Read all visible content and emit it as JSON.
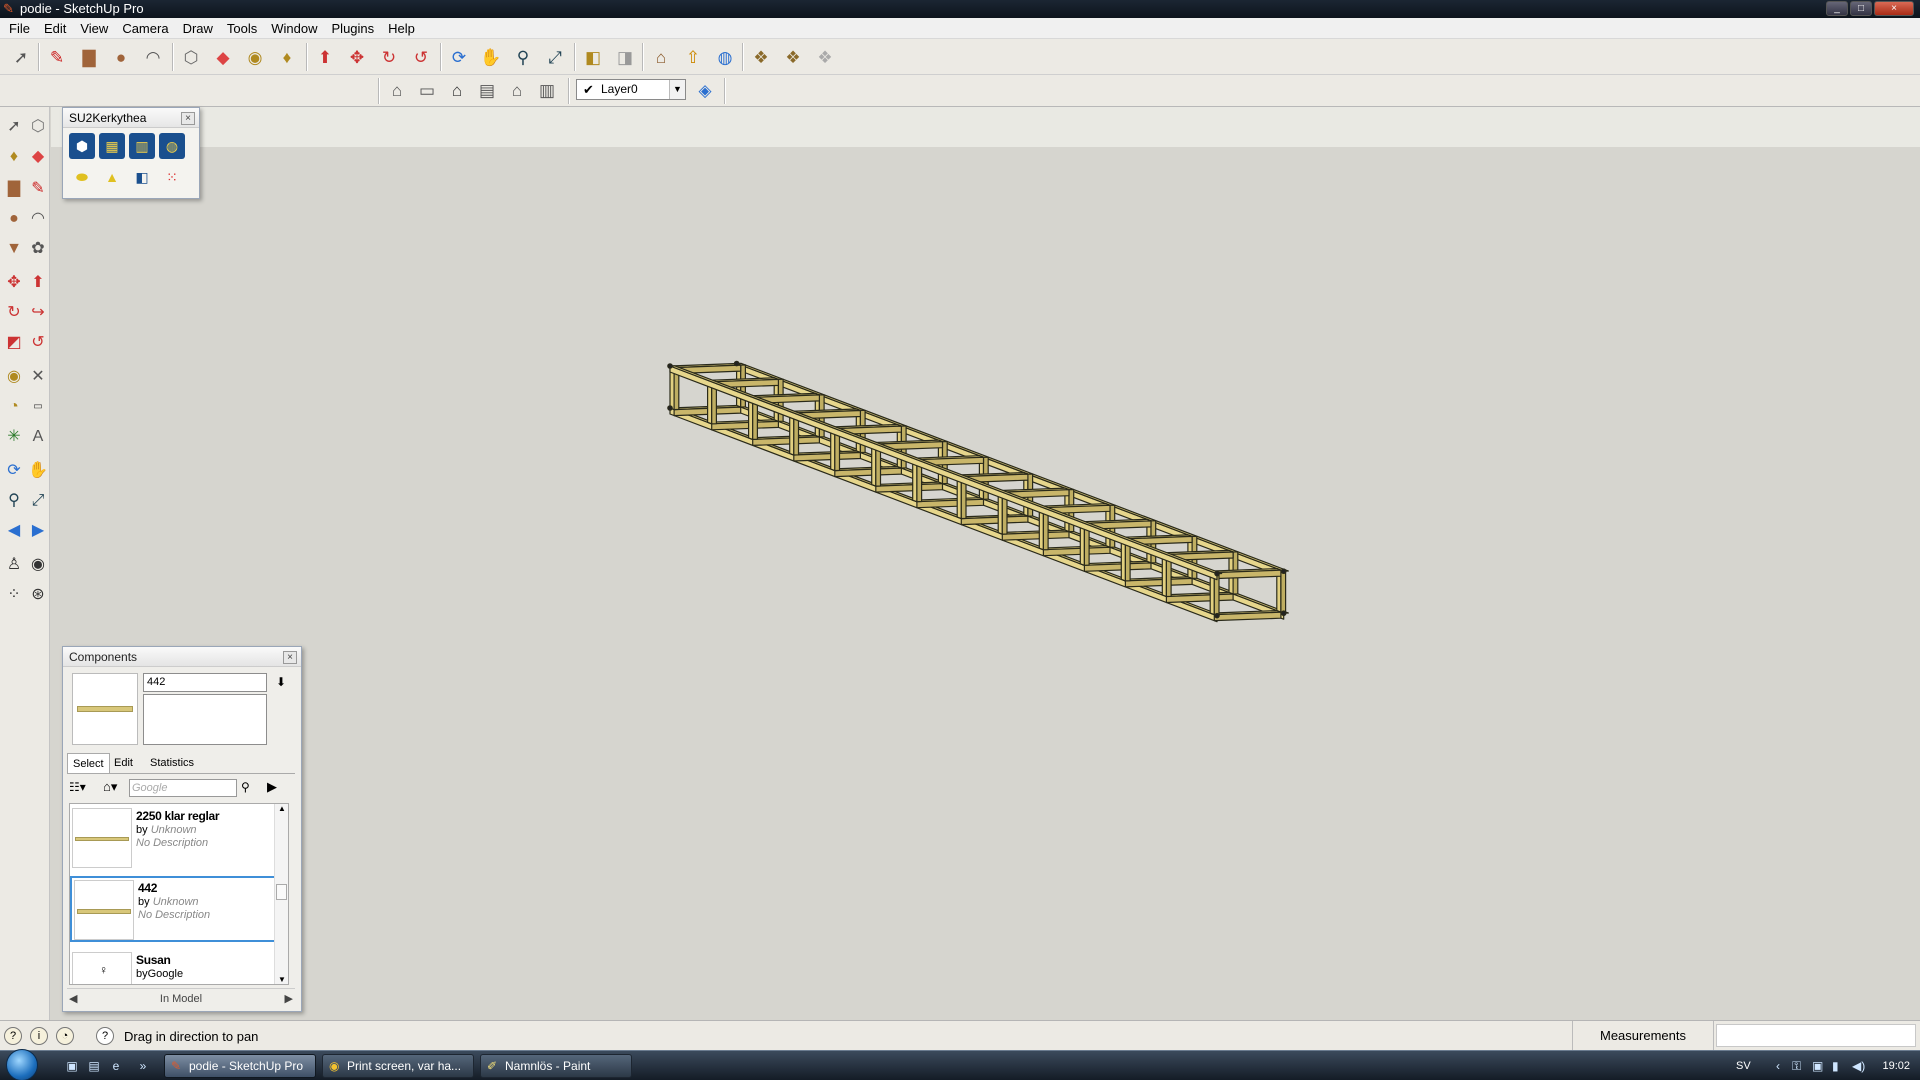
{
  "window": {
    "title": "podie - SketchUp Pro",
    "controls": [
      "_",
      "□",
      "×"
    ]
  },
  "menu": {
    "items": [
      "File",
      "Edit",
      "View",
      "Camera",
      "Draw",
      "Tools",
      "Window",
      "Plugins",
      "Help"
    ]
  },
  "toolbar": {
    "layer": {
      "value": "Layer0"
    }
  },
  "su2kerkythea": {
    "title": "SU2Kerkythea",
    "close": "×"
  },
  "components": {
    "title": "Components",
    "close": "×",
    "name_value": "442",
    "tabs": [
      "Select",
      "Edit",
      "Statistics"
    ],
    "search_placeholder": "Google",
    "items": [
      {
        "name": "2250 klar reglar",
        "by_prefix": "by",
        "author": "Unknown",
        "description": "No Description"
      },
      {
        "name": "442",
        "by_prefix": "by",
        "author": "Unknown",
        "description": "No Description",
        "selected": true
      },
      {
        "name": "Susan",
        "by_prefix": "by",
        "author": "Google",
        "description": ""
      }
    ],
    "footer": "In Model"
  },
  "status": {
    "hint": "Drag in direction to pan",
    "measurements_label": "Measurements",
    "measurements_value": ""
  },
  "taskbar": {
    "buttons": [
      {
        "label": "podie - SketchUp Pro",
        "active": true
      },
      {
        "label": "Print screen, var ha...",
        "active": false
      },
      {
        "label": "Namnlös - Paint",
        "active": false
      }
    ],
    "language": "SV",
    "clock": "19:02"
  },
  "colors": {
    "wood": "#d8c77a",
    "wood_edge": "#2a2a1a",
    "viewport_bg": "#d6d5cf",
    "selection_blue": "#3f8fd8"
  }
}
